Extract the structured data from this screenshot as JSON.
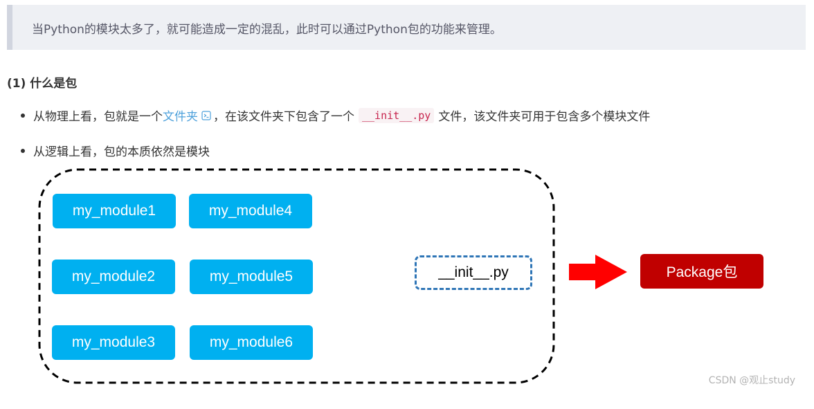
{
  "quote": {
    "text": "当Python的模块太多了，就可能造成一定的混乱，此时可以通过Python包的功能来管理。"
  },
  "section": {
    "heading": "(1) 什么是包",
    "bullet1": {
      "before": "从物理上看，包就是一个",
      "link": "文件夹",
      "middle": "，在该文件夹下包含了一个",
      "code": "__init__.py",
      "after": "文件，该文件夹可用于包含多个模块文件"
    },
    "bullet2": {
      "text": "从逻辑上看，包的本质依然是模块"
    }
  },
  "diagram": {
    "modules": [
      "my_module1",
      "my_module4",
      "my_module2",
      "my_module5",
      "my_module3",
      "my_module6"
    ],
    "init_file": "__init__.py",
    "package_label": "Package包",
    "colors": {
      "module": "#00b0f0",
      "init_border": "#2e75b6",
      "arrow": "#ff0000",
      "package": "#c00000"
    }
  },
  "watermark": "CSDN @观止study"
}
